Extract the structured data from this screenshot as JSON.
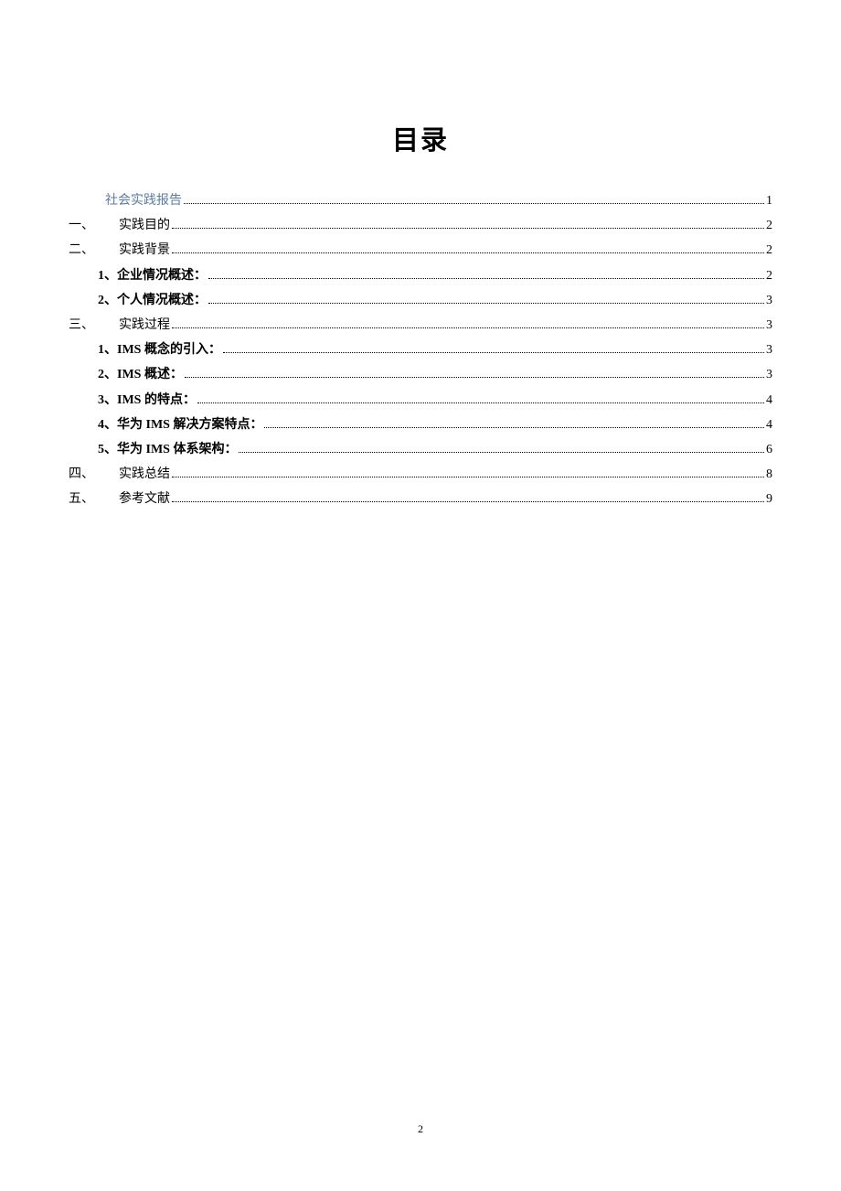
{
  "title": "目录",
  "page_number": "2",
  "toc": [
    {
      "prefix": "",
      "label": "社会实践报告",
      "page": "1",
      "level": 0,
      "bold": false
    },
    {
      "prefix": "一、",
      "label": "实践目的",
      "page": "2",
      "level": 1,
      "bold": false
    },
    {
      "prefix": "二、",
      "label": "实践背景",
      "page": "2",
      "level": 1,
      "bold": false
    },
    {
      "prefix": "1、",
      "label": "企业情况概述：",
      "page": "2",
      "level": 2,
      "bold": true
    },
    {
      "prefix": "2、",
      "label": "个人情况概述：",
      "page": "3",
      "level": 2,
      "bold": true
    },
    {
      "prefix": "三、",
      "label": "实践过程",
      "page": "3",
      "level": 1,
      "bold": false
    },
    {
      "prefix": "1、",
      "label": "IMS 概念的引入：",
      "page": "3",
      "level": 2,
      "bold": true
    },
    {
      "prefix": "2、",
      "label": "IMS 概述：",
      "page": "3",
      "level": 2,
      "bold": true
    },
    {
      "prefix": "3、",
      "label": "IMS 的特点：",
      "page": "4",
      "level": 2,
      "bold": true
    },
    {
      "prefix": "4、",
      "label": "华为 IMS 解决方案特点：",
      "page": "4",
      "level": 2,
      "bold": true
    },
    {
      "prefix": "5、",
      "label": "华为 IMS 体系架构：",
      "page": "6",
      "level": 2,
      "bold": true
    },
    {
      "prefix": "四、",
      "label": "实践总结",
      "page": "8",
      "level": 1,
      "bold": false
    },
    {
      "prefix": "五、",
      "label": "参考文献",
      "page": "9",
      "level": 1,
      "bold": false
    }
  ]
}
